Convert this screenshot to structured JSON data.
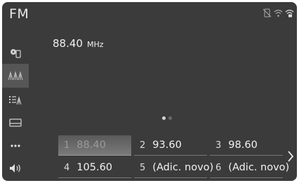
{
  "header": {
    "title": "FM"
  },
  "station": {
    "frequency": "88.40",
    "unit": "MHz"
  },
  "sidebar": {
    "items": [
      {
        "icon": "source-disc-icon",
        "active": false
      },
      {
        "icon": "station-list-icon",
        "active": true
      },
      {
        "icon": "category-list-icon",
        "active": false
      },
      {
        "icon": "keypad-icon",
        "active": false
      },
      {
        "icon": "more-options-icon",
        "active": false
      },
      {
        "icon": "volume-icon",
        "active": false
      }
    ]
  },
  "pager": {
    "pages": 2,
    "current": 1
  },
  "presets": [
    {
      "num": "1",
      "value": "88.40",
      "selected": true
    },
    {
      "num": "2",
      "value": "93.60",
      "selected": false
    },
    {
      "num": "3",
      "value": "98.60",
      "selected": false
    },
    {
      "num": "4",
      "value": "105.60",
      "selected": false
    },
    {
      "num": "5",
      "value": "(Adic. novo)",
      "selected": false
    },
    {
      "num": "6",
      "value": "(Adic. novo)",
      "selected": false
    }
  ],
  "colors": {
    "background": "#3b3b3b",
    "text": "#f0f0f0",
    "selected_bg": "#6a6a6a"
  }
}
